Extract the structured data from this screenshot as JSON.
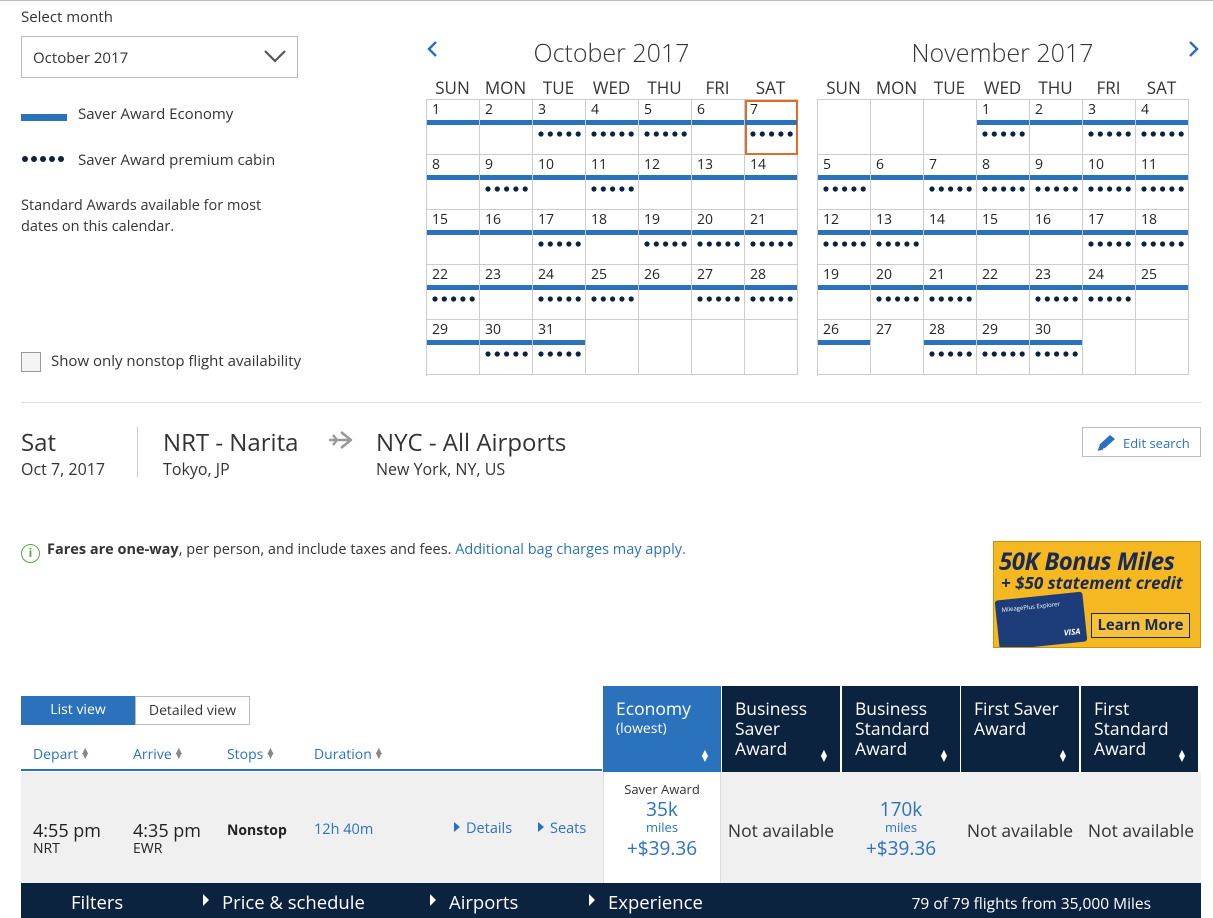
{
  "left_panel": {
    "select_label": "Select month",
    "selected_month": "October 2017",
    "legend_economy": "Saver Award Economy",
    "legend_premium": "Saver Award premium cabin",
    "standard_note": "Standard Awards available for most dates on this calendar.",
    "nonstop_checkbox_label": "Show only nonstop flight availability"
  },
  "weekdays": [
    "SUN",
    "MON",
    "TUE",
    "WED",
    "THU",
    "FRI",
    "SAT"
  ],
  "calendars": [
    {
      "title": "October 2017",
      "first_weekday": 0,
      "days": 31,
      "selected_day": 7,
      "economy_days": [
        1,
        2,
        3,
        4,
        5,
        6,
        7,
        8,
        9,
        10,
        11,
        12,
        13,
        14,
        15,
        16,
        17,
        18,
        19,
        20,
        21,
        22,
        23,
        24,
        25,
        26,
        27,
        28,
        29,
        30,
        31
      ],
      "premium_days": [
        3,
        4,
        5,
        7,
        9,
        11,
        17,
        19,
        20,
        21,
        22,
        24,
        25,
        27,
        28,
        30,
        31
      ]
    },
    {
      "title": "November 2017",
      "first_weekday": 3,
      "days": 30,
      "selected_day": null,
      "economy_days": [
        1,
        2,
        3,
        4,
        5,
        6,
        7,
        8,
        9,
        10,
        11,
        12,
        13,
        14,
        15,
        16,
        17,
        18,
        19,
        20,
        21,
        22,
        23,
        24,
        25,
        26,
        28,
        29,
        30
      ],
      "premium_days": [
        1,
        3,
        4,
        5,
        7,
        8,
        9,
        10,
        11,
        12,
        13,
        17,
        18,
        20,
        21,
        23,
        24,
        28,
        29,
        30
      ]
    }
  ],
  "trip": {
    "day": "Sat",
    "date": "Oct 7, 2017",
    "origin_code": "NRT - Narita",
    "origin_city": "Tokyo, JP",
    "dest_code": "NYC - All Airports",
    "dest_city": "New York, NY, US",
    "edit_label": "Edit search"
  },
  "fare_note": {
    "bold": "Fares are one-way",
    "rest": ", per person, and include taxes and fees. ",
    "link": "Additional bag charges may apply."
  },
  "ad": {
    "line1": "50K Bonus Miles",
    "line2": "+ $50 statement credit",
    "card_name": "MileagePlus Explorer",
    "card_brand": "VISA",
    "cta": "Learn More"
  },
  "view_tabs": {
    "list": "List view",
    "detailed": "Detailed view"
  },
  "sort_headers": {
    "depart": "Depart",
    "arrive": "Arrive",
    "stops": "Stops",
    "duration": "Duration"
  },
  "fare_columns": [
    {
      "title": "Economy",
      "sub": "(lowest)"
    },
    {
      "title": "Business Saver Award",
      "sub": ""
    },
    {
      "title": "Business Standard Award",
      "sub": ""
    },
    {
      "title": "First Saver Award",
      "sub": ""
    },
    {
      "title": "First Standard Award",
      "sub": ""
    }
  ],
  "flight": {
    "depart_time": "4:55 pm",
    "depart_airport": "NRT",
    "arrive_time": "4:35 pm",
    "arrive_airport": "EWR",
    "stops": "Nonstop",
    "duration": "12h 40m",
    "details_link": "Details",
    "seats_link": "Seats",
    "econ_award": "Saver Award",
    "econ_miles": "35k",
    "econ_miles_label": "miles",
    "econ_tax": "+$39.36",
    "biz_saver": "Not available",
    "biz_std_miles": "170k",
    "biz_std_miles_label": "miles",
    "biz_std_tax": "+$39.36",
    "first_saver": "Not available",
    "first_std": "Not available"
  },
  "bottom_bar": {
    "filters": "Filters",
    "price": "Price & schedule",
    "airports": "Airports",
    "experience": "Experience",
    "count": "79 of 79 flights from 35,000 Miles"
  },
  "colors": {
    "accent": "#2b72bd",
    "navy": "#0c2340",
    "selected_outline": "#e16b2b"
  }
}
